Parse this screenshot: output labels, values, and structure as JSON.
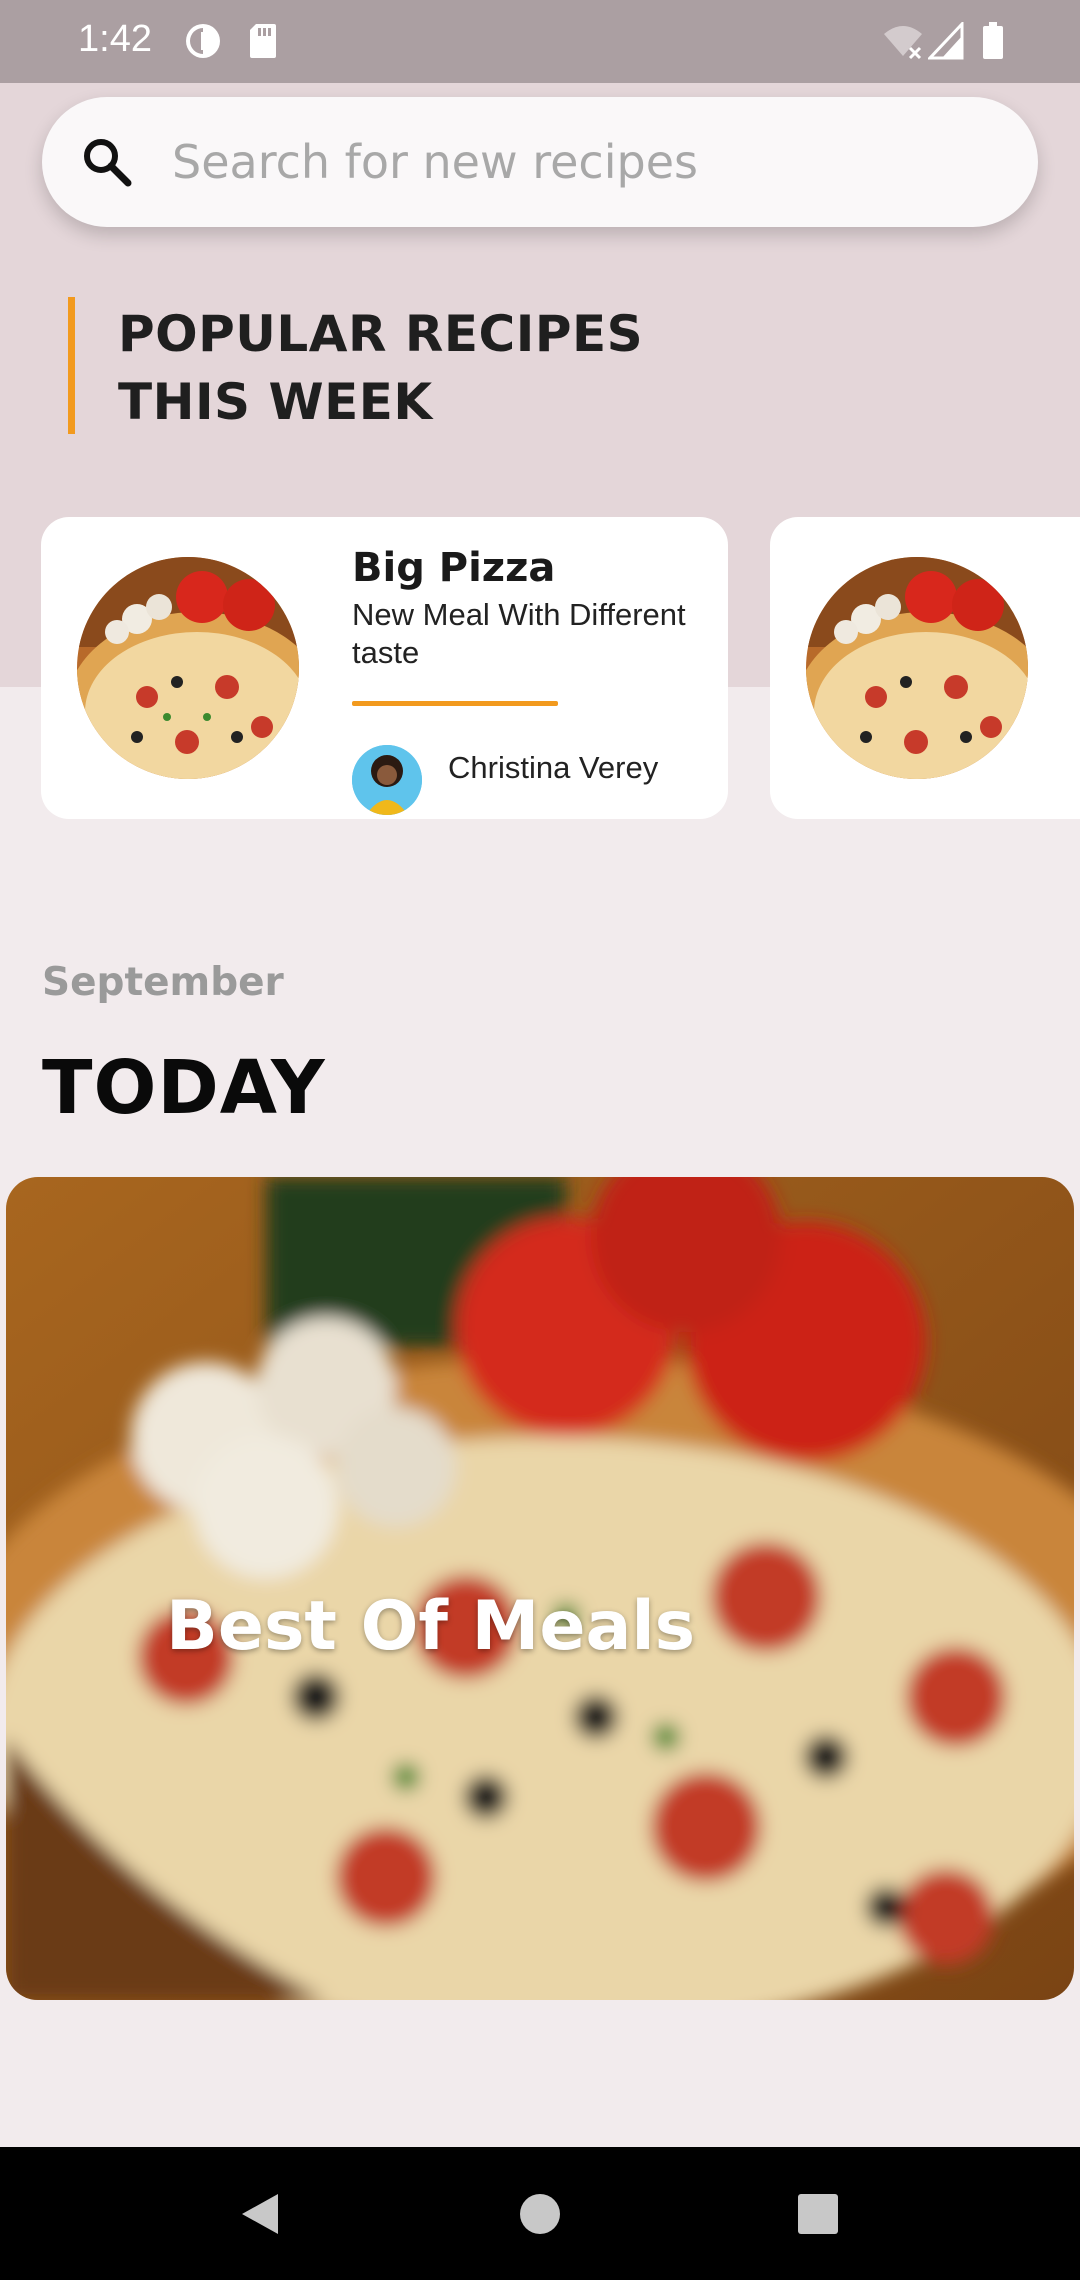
{
  "status_bar": {
    "time": "1:42"
  },
  "search": {
    "placeholder": "Search for new recipes"
  },
  "section": {
    "title_line1": "POPULAR RECIPES",
    "title_line2": "THIS WEEK"
  },
  "popular_recipes": [
    {
      "title": "Big Pizza",
      "subtitle": "New Meal With Different taste",
      "author": "Christina Verey"
    }
  ],
  "today": {
    "month": "September",
    "label": "TODAY",
    "feature_title": "Best Of Meals"
  },
  "colors": {
    "accent": "#f29a1e",
    "status_bar": "#ab9fa2",
    "top_background": "#e4d6d9",
    "page_background": "#f2ebed"
  }
}
